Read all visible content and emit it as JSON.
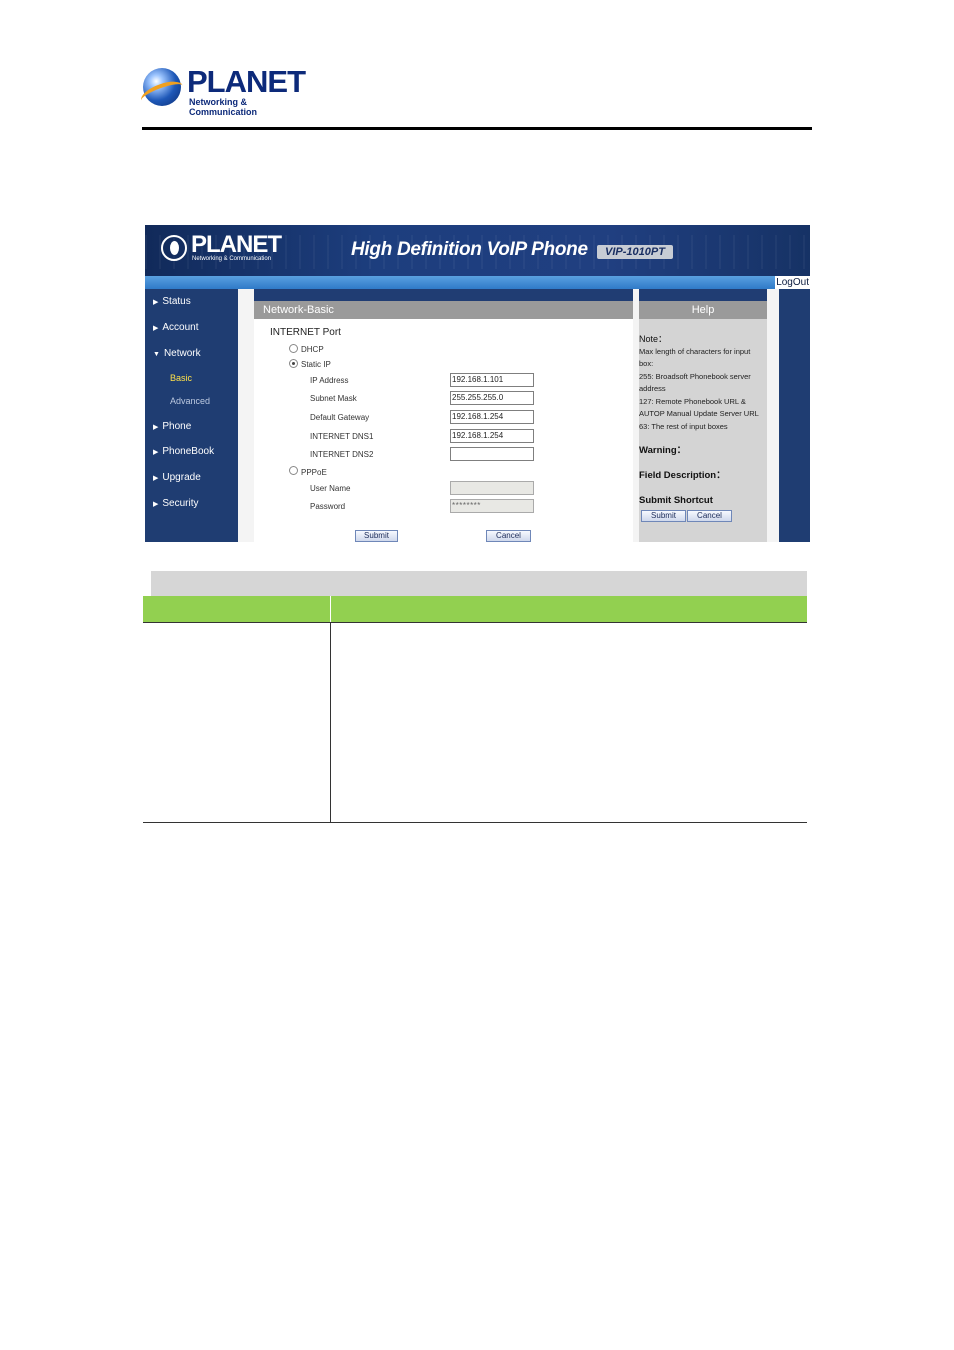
{
  "doc_header": {
    "brand": "PLANET",
    "tagline": "Networking & Communication"
  },
  "screenshot": {
    "banner": {
      "brand": "PLANET",
      "tagline": "Networking & Communication",
      "title": "High Definition VoIP Phone",
      "model": "VIP-1010PT",
      "logout": "LogOut"
    },
    "sidebar": {
      "items": [
        {
          "label": "Status"
        },
        {
          "label": "Account"
        },
        {
          "label": "Network"
        },
        {
          "label": "Phone"
        },
        {
          "label": "PhoneBook"
        },
        {
          "label": "Upgrade"
        },
        {
          "label": "Security"
        }
      ],
      "subitems": [
        {
          "label": "Basic"
        },
        {
          "label": "Advanced"
        }
      ]
    },
    "content": {
      "title": "Network-Basic",
      "section": "INTERNET Port",
      "dhcp_label": "DHCP",
      "static_label": "Static IP",
      "pppoe_label": "PPPoE",
      "selected_mode": "Static IP",
      "fields": {
        "ip_address": {
          "label": "IP Address",
          "value": "192.168.1.101"
        },
        "subnet_mask": {
          "label": "Subnet Mask",
          "value": "255.255.255.0"
        },
        "default_gateway": {
          "label": "Default Gateway",
          "value": "192.168.1.254"
        },
        "dns1": {
          "label": "INTERNET DNS1",
          "value": "192.168.1.254"
        },
        "dns2": {
          "label": "INTERNET DNS2",
          "value": ""
        },
        "user_name": {
          "label": "User Name",
          "value": ""
        },
        "password": {
          "label": "Password",
          "value": "********"
        }
      },
      "submit": "Submit",
      "cancel": "Cancel"
    },
    "help": {
      "title": "Help",
      "note_head": "Note：",
      "note_lines": [
        "Max length of characters for input",
        "box:",
        "255: Broadsoft Phonebook server",
        "address",
        "127: Remote Phonebook URL &",
        "AUTOP Manual Update Server URL",
        "63: The rest of input boxes"
      ],
      "warning_head": "Warning：",
      "field_desc_head": "Field Description：",
      "shortcut_head": "Submit Shortcut",
      "submit": "Submit",
      "cancel": "Cancel"
    }
  },
  "colors": {
    "nav_blue": "#1f3d72",
    "active_sub": "#ffe14a",
    "table_header_green": "#92d050",
    "table_title_gray": "#d6d6d6"
  }
}
